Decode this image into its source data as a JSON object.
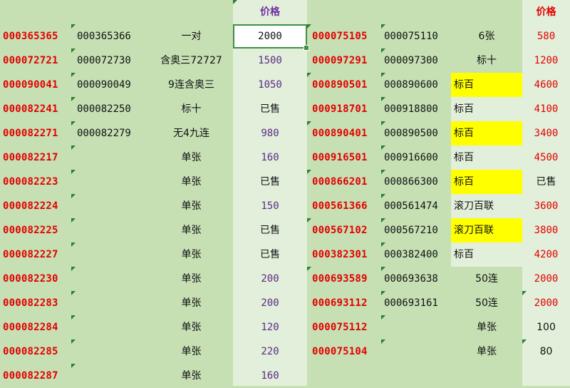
{
  "left": {
    "header_price": "价格",
    "rows": [
      {
        "code": "000365365",
        "code2": "000365366",
        "label": "一对",
        "price": "2000"
      },
      {
        "code": "000072721",
        "code2": "000072730",
        "label": "含奥三72727",
        "price": "1500"
      },
      {
        "code": "000090041",
        "code2": "000090049",
        "label": "9连含奥三",
        "price": "1050"
      },
      {
        "code": "000082241",
        "code2": "000082250",
        "label": "标十",
        "price": "已售"
      },
      {
        "code": "000082271",
        "code2": "000082279",
        "label": "无4九连",
        "price": "980"
      },
      {
        "code": "000082217",
        "code2": "",
        "label": "单张",
        "price": "160"
      },
      {
        "code": "000082223",
        "code2": "",
        "label": "单张",
        "price": "已售"
      },
      {
        "code": "000082224",
        "code2": "",
        "label": "单张",
        "price": "150"
      },
      {
        "code": "000082225",
        "code2": "",
        "label": "单张",
        "price": "已售"
      },
      {
        "code": "000082227",
        "code2": "",
        "label": "单张",
        "price": "已售"
      },
      {
        "code": "000082230",
        "code2": "",
        "label": "单张",
        "price": "200"
      },
      {
        "code": "000082283",
        "code2": "",
        "label": "单张",
        "price": "200"
      },
      {
        "code": "000082284",
        "code2": "",
        "label": "单张",
        "price": "120"
      },
      {
        "code": "000082285",
        "code2": "",
        "label": "单张",
        "price": "220"
      },
      {
        "code": "000082287",
        "code2": "",
        "label": "单张",
        "price": "160"
      }
    ]
  },
  "right": {
    "header_price": "价格",
    "rows": [
      {
        "code": "000075105",
        "code2": "000075110",
        "label": "6张",
        "price": "580",
        "yellow": false
      },
      {
        "code": "000097291",
        "code2": "000097300",
        "label": "标十",
        "price": "1200",
        "yellow": false
      },
      {
        "code": "000890501",
        "code2": "000890600",
        "label": "标百",
        "price": "4600",
        "yellow": true
      },
      {
        "code": "000918701",
        "code2": "000918800",
        "label": "标百",
        "price": "4100",
        "yellow": false
      },
      {
        "code": "000890401",
        "code2": "000890500",
        "label": "标百",
        "price": "3400",
        "yellow": true
      },
      {
        "code": "000916501",
        "code2": "000916600",
        "label": "标百",
        "price": "4500",
        "yellow": false
      },
      {
        "code": "000866201",
        "code2": "000866300",
        "label": "标百",
        "price": "已售",
        "yellow": true
      },
      {
        "code": "000561366",
        "code2": "000561474",
        "label": "滚刀百联",
        "price": "3600",
        "yellow": false
      },
      {
        "code": "000567102",
        "code2": "000567210",
        "label": "滚刀百联",
        "price": "3800",
        "yellow": true
      },
      {
        "code": "000382301",
        "code2": "000382400",
        "label": "标百",
        "price": "4200",
        "yellow": false
      },
      {
        "code": "000693589",
        "code2": "000693638",
        "label": "50连",
        "price": "2000",
        "yellow": false
      },
      {
        "code": "000693112",
        "code2": "000693161",
        "label": "50连",
        "price": "2000",
        "yellow": false
      },
      {
        "code": "000075112",
        "code2": "",
        "label": "单张",
        "price": "100",
        "yellow": false
      },
      {
        "code": "000075104",
        "code2": "",
        "label": "单张",
        "price": "80",
        "yellow": false
      }
    ]
  },
  "colors": {
    "code_red": "#e30000",
    "price_purple": "#5b2a86",
    "highlight_yellow": "#ffff00",
    "grid_green": "#c6e0b4",
    "light_green": "#e2efda"
  }
}
